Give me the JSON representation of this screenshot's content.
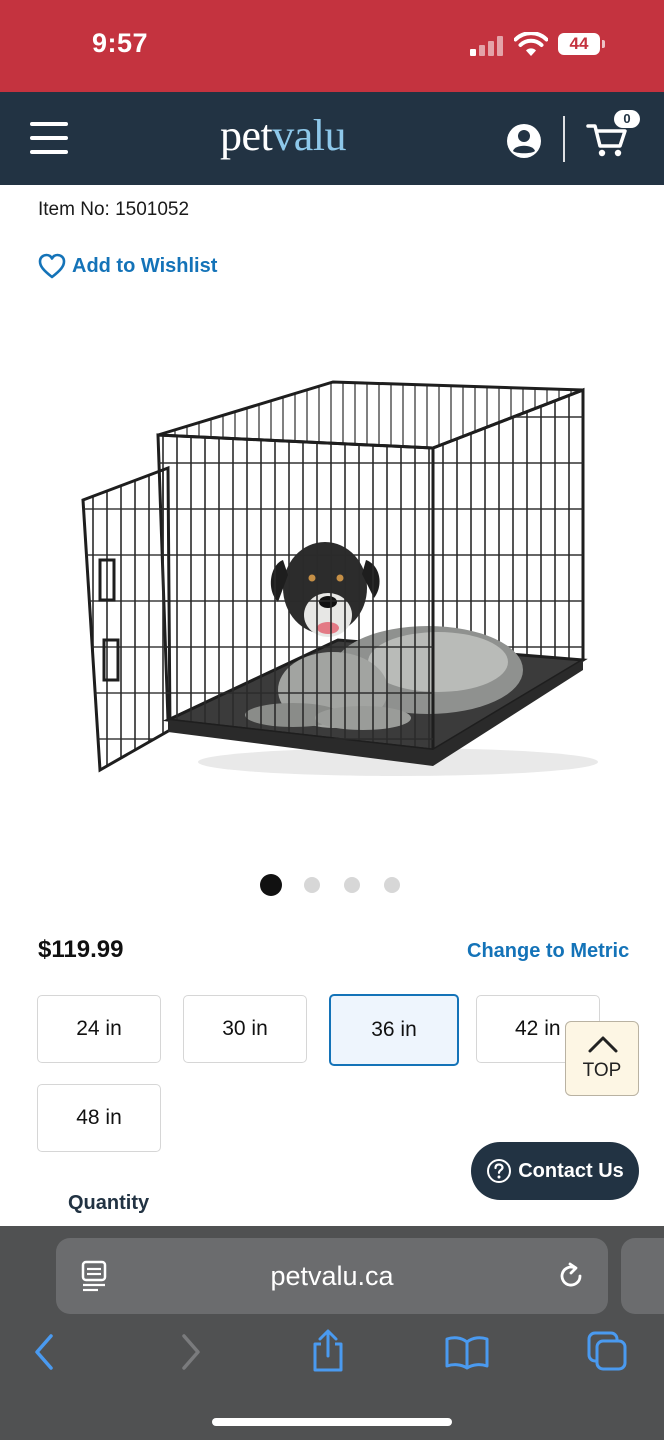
{
  "status_bar": {
    "time": "9:57",
    "battery": "44"
  },
  "header": {
    "logo_pet": "pet",
    "logo_valu": "valu",
    "cart_count": "0"
  },
  "product": {
    "item_number": "Item No: 1501052",
    "wishlist_label": "Add to Wishlist",
    "image_alt": "wire-dog-crate-with-dog",
    "carousel": {
      "total": 4,
      "active_index": 0
    },
    "price": "$119.99",
    "change_units_label": "Change to Metric",
    "sizes": [
      "24 in",
      "30 in",
      "36 in",
      "42 in",
      "48 in"
    ],
    "selected_size": "36 in",
    "quantity_label": "Quantity"
  },
  "floating": {
    "top_label": "TOP",
    "contact_label": "Contact Us"
  },
  "browser": {
    "url": "petvalu.ca"
  },
  "colors": {
    "status_bar": "#c4333f",
    "header": "#223343",
    "accent_blue": "#1473b8",
    "browser_chrome": "#505152"
  },
  "icons": [
    "menu-icon",
    "account-icon",
    "cart-icon",
    "heart-icon",
    "chevron-up-icon",
    "help-circle-icon",
    "reader-icon",
    "reload-icon",
    "back-icon",
    "forward-icon",
    "share-icon",
    "bookmarks-icon",
    "tabs-icon"
  ]
}
